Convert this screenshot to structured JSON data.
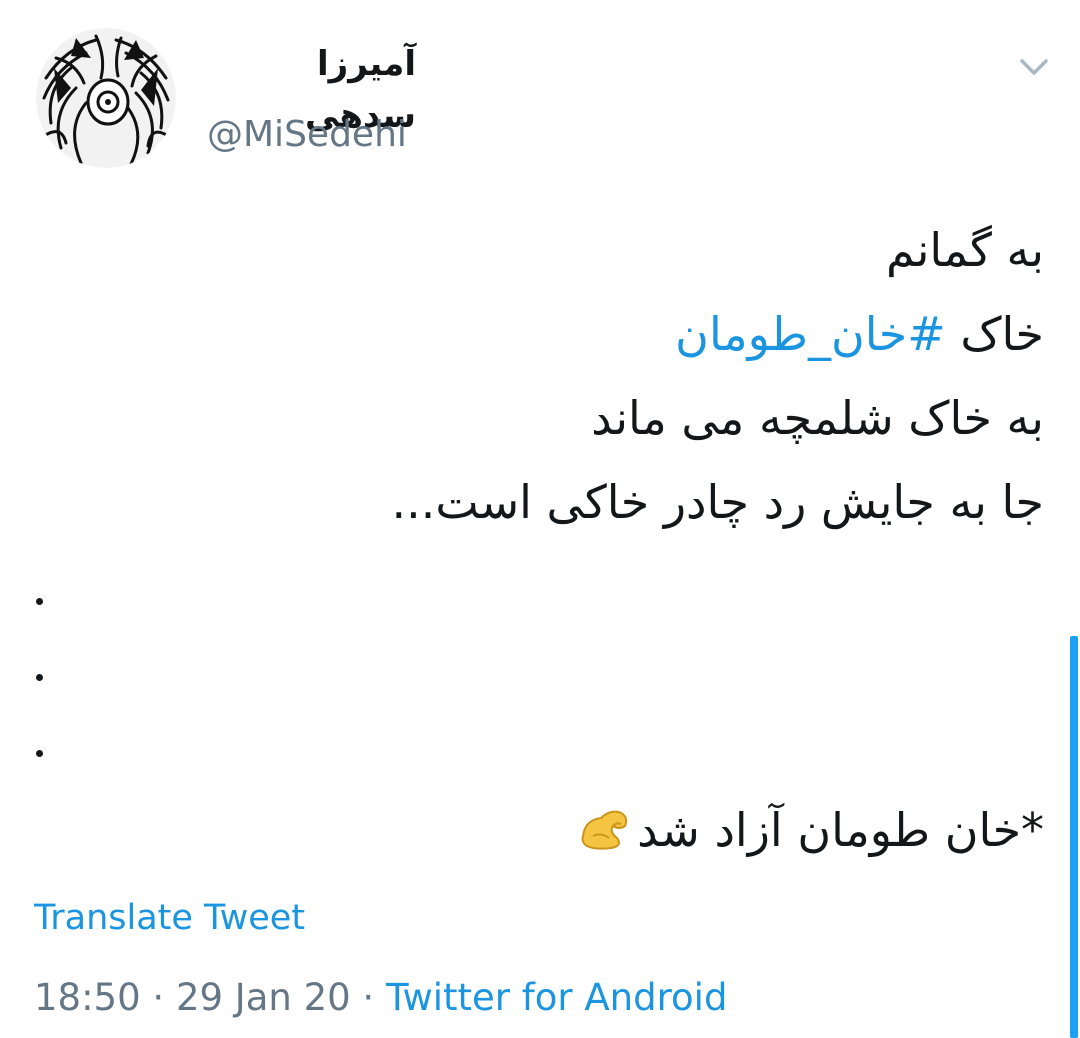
{
  "tweet": {
    "author": {
      "display_name": "آمیرزا سدهی",
      "handle": "@MiSedehi",
      "avatar_icon": "sketch-face-avatar"
    },
    "menu_icon": "chevron-down-icon",
    "body": {
      "line1": "به گمانم",
      "line2_prefix": "خاک ",
      "line2_hashtag": "#خان_طومان",
      "line3": "به خاک شلمچه می ماند",
      "line4": "جا به جایش رد چادر خاکی است...",
      "footer_line": "*خان طومان آزاد شد",
      "footer_emoji": "flexed-biceps-emoji"
    },
    "translate_label": "Translate Tweet",
    "time": "18:50",
    "separator": " · ",
    "date": "29 Jan 20",
    "source": "Twitter for Android"
  },
  "colors": {
    "link": "#1b95e0",
    "muted": "#657786",
    "text": "#14171a",
    "scroll": "#1da1f2"
  }
}
